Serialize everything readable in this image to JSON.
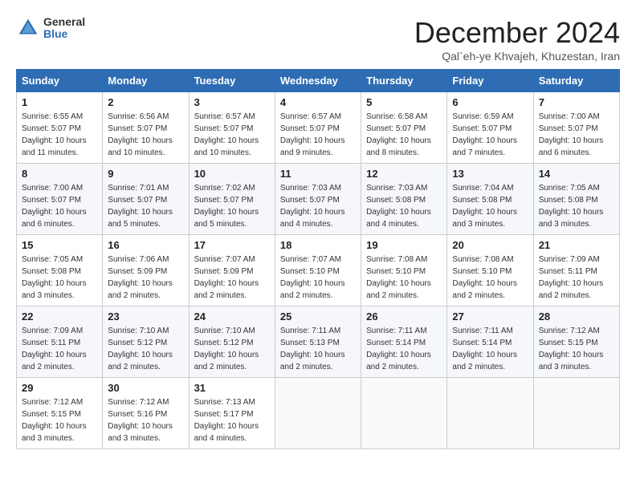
{
  "logo": {
    "general": "General",
    "blue": "Blue"
  },
  "title": "December 2024",
  "subtitle": "Qal`eh-ye Khvajeh, Khuzestan, Iran",
  "weekdays": [
    "Sunday",
    "Monday",
    "Tuesday",
    "Wednesday",
    "Thursday",
    "Friday",
    "Saturday"
  ],
  "weeks": [
    [
      {
        "day": "1",
        "sunrise": "6:55 AM",
        "sunset": "5:07 PM",
        "daylight": "10 hours and 11 minutes."
      },
      {
        "day": "2",
        "sunrise": "6:56 AM",
        "sunset": "5:07 PM",
        "daylight": "10 hours and 10 minutes."
      },
      {
        "day": "3",
        "sunrise": "6:57 AM",
        "sunset": "5:07 PM",
        "daylight": "10 hours and 10 minutes."
      },
      {
        "day": "4",
        "sunrise": "6:57 AM",
        "sunset": "5:07 PM",
        "daylight": "10 hours and 9 minutes."
      },
      {
        "day": "5",
        "sunrise": "6:58 AM",
        "sunset": "5:07 PM",
        "daylight": "10 hours and 8 minutes."
      },
      {
        "day": "6",
        "sunrise": "6:59 AM",
        "sunset": "5:07 PM",
        "daylight": "10 hours and 7 minutes."
      },
      {
        "day": "7",
        "sunrise": "7:00 AM",
        "sunset": "5:07 PM",
        "daylight": "10 hours and 6 minutes."
      }
    ],
    [
      {
        "day": "8",
        "sunrise": "7:00 AM",
        "sunset": "5:07 PM",
        "daylight": "10 hours and 6 minutes."
      },
      {
        "day": "9",
        "sunrise": "7:01 AM",
        "sunset": "5:07 PM",
        "daylight": "10 hours and 5 minutes."
      },
      {
        "day": "10",
        "sunrise": "7:02 AM",
        "sunset": "5:07 PM",
        "daylight": "10 hours and 5 minutes."
      },
      {
        "day": "11",
        "sunrise": "7:03 AM",
        "sunset": "5:07 PM",
        "daylight": "10 hours and 4 minutes."
      },
      {
        "day": "12",
        "sunrise": "7:03 AM",
        "sunset": "5:08 PM",
        "daylight": "10 hours and 4 minutes."
      },
      {
        "day": "13",
        "sunrise": "7:04 AM",
        "sunset": "5:08 PM",
        "daylight": "10 hours and 3 minutes."
      },
      {
        "day": "14",
        "sunrise": "7:05 AM",
        "sunset": "5:08 PM",
        "daylight": "10 hours and 3 minutes."
      }
    ],
    [
      {
        "day": "15",
        "sunrise": "7:05 AM",
        "sunset": "5:08 PM",
        "daylight": "10 hours and 3 minutes."
      },
      {
        "day": "16",
        "sunrise": "7:06 AM",
        "sunset": "5:09 PM",
        "daylight": "10 hours and 2 minutes."
      },
      {
        "day": "17",
        "sunrise": "7:07 AM",
        "sunset": "5:09 PM",
        "daylight": "10 hours and 2 minutes."
      },
      {
        "day": "18",
        "sunrise": "7:07 AM",
        "sunset": "5:10 PM",
        "daylight": "10 hours and 2 minutes."
      },
      {
        "day": "19",
        "sunrise": "7:08 AM",
        "sunset": "5:10 PM",
        "daylight": "10 hours and 2 minutes."
      },
      {
        "day": "20",
        "sunrise": "7:08 AM",
        "sunset": "5:10 PM",
        "daylight": "10 hours and 2 minutes."
      },
      {
        "day": "21",
        "sunrise": "7:09 AM",
        "sunset": "5:11 PM",
        "daylight": "10 hours and 2 minutes."
      }
    ],
    [
      {
        "day": "22",
        "sunrise": "7:09 AM",
        "sunset": "5:11 PM",
        "daylight": "10 hours and 2 minutes."
      },
      {
        "day": "23",
        "sunrise": "7:10 AM",
        "sunset": "5:12 PM",
        "daylight": "10 hours and 2 minutes."
      },
      {
        "day": "24",
        "sunrise": "7:10 AM",
        "sunset": "5:12 PM",
        "daylight": "10 hours and 2 minutes."
      },
      {
        "day": "25",
        "sunrise": "7:11 AM",
        "sunset": "5:13 PM",
        "daylight": "10 hours and 2 minutes."
      },
      {
        "day": "26",
        "sunrise": "7:11 AM",
        "sunset": "5:14 PM",
        "daylight": "10 hours and 2 minutes."
      },
      {
        "day": "27",
        "sunrise": "7:11 AM",
        "sunset": "5:14 PM",
        "daylight": "10 hours and 2 minutes."
      },
      {
        "day": "28",
        "sunrise": "7:12 AM",
        "sunset": "5:15 PM",
        "daylight": "10 hours and 3 minutes."
      }
    ],
    [
      {
        "day": "29",
        "sunrise": "7:12 AM",
        "sunset": "5:15 PM",
        "daylight": "10 hours and 3 minutes."
      },
      {
        "day": "30",
        "sunrise": "7:12 AM",
        "sunset": "5:16 PM",
        "daylight": "10 hours and 3 minutes."
      },
      {
        "day": "31",
        "sunrise": "7:13 AM",
        "sunset": "5:17 PM",
        "daylight": "10 hours and 4 minutes."
      },
      null,
      null,
      null,
      null
    ]
  ],
  "labels": {
    "sunrise": "Sunrise:",
    "sunset": "Sunset:",
    "daylight": "Daylight:"
  }
}
